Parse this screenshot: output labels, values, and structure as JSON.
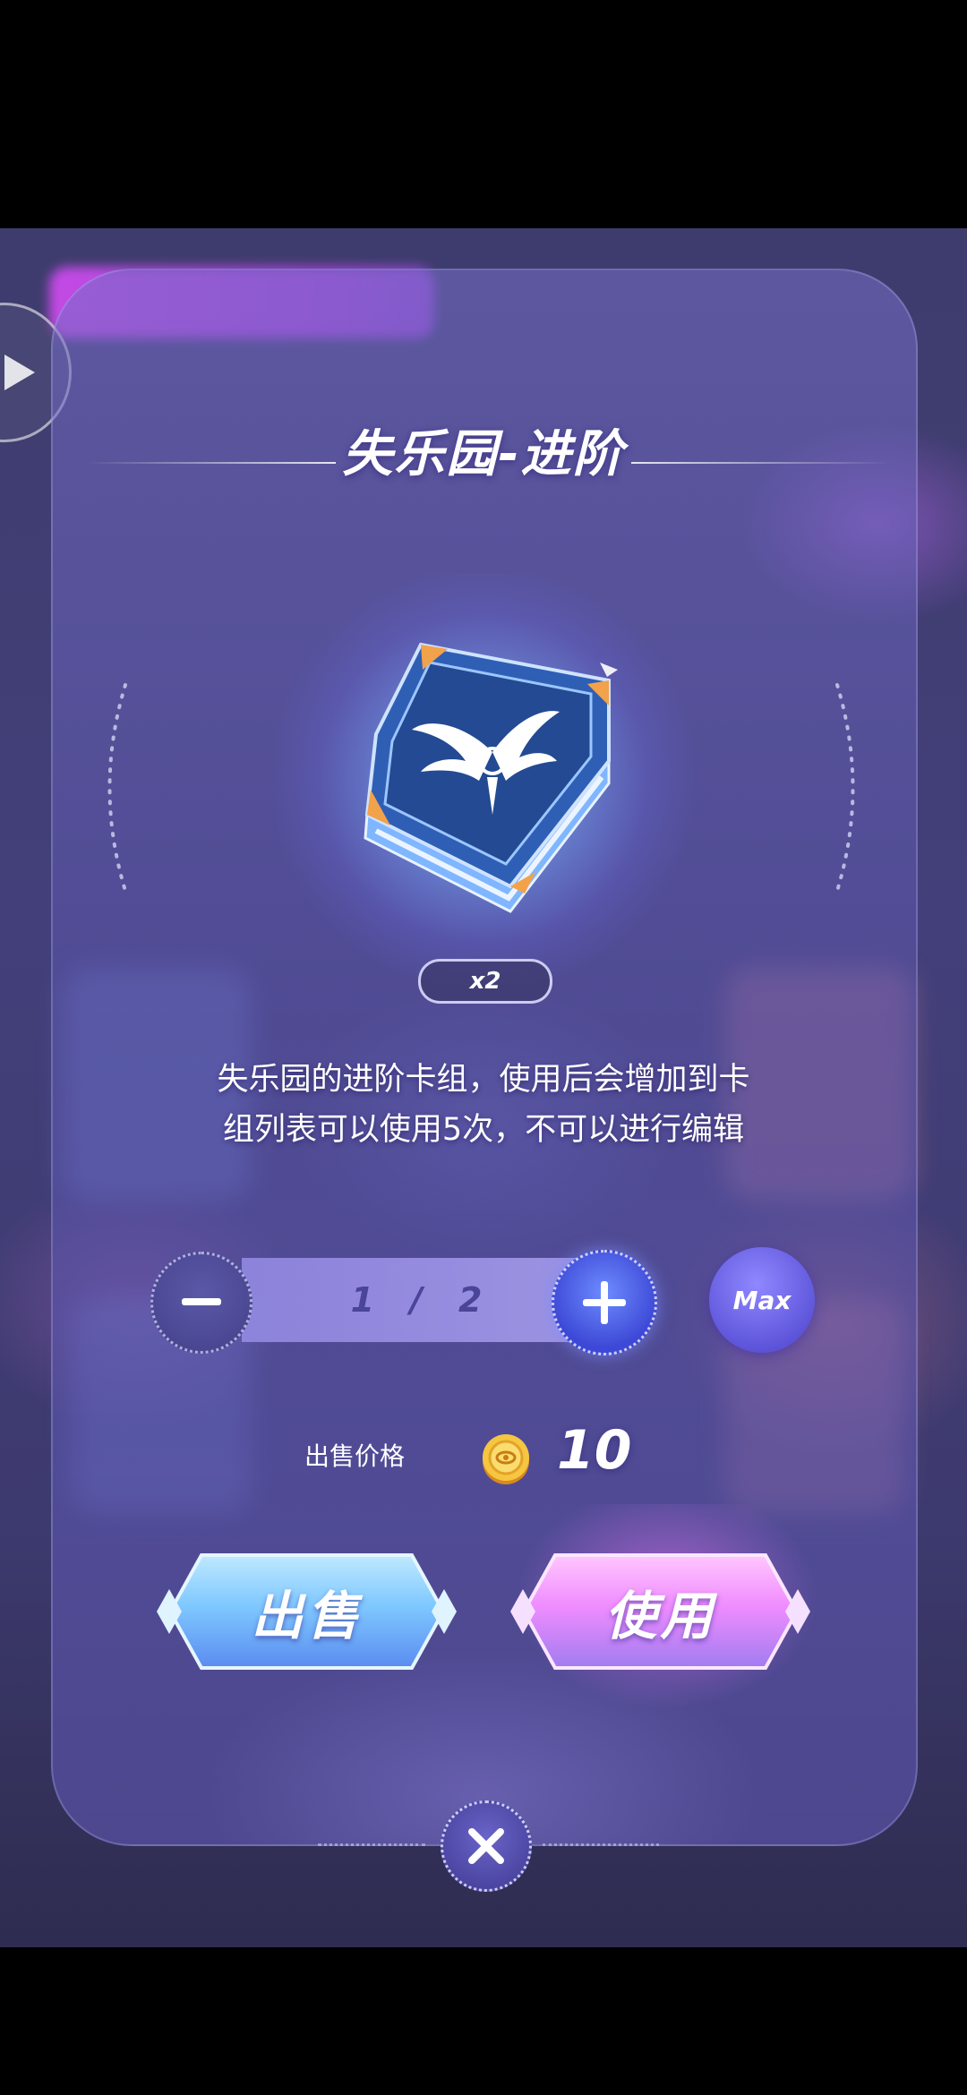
{
  "dialog": {
    "title": "失乐园-进阶",
    "item_count_badge": "x2",
    "description_line1": "失乐园的进阶卡组，使用后会增加到卡",
    "description_line2": "组列表可以使用5次，不可以进行编辑",
    "quantity": {
      "current": "1",
      "separator": "/",
      "max": "2",
      "max_button_label": "Max"
    },
    "price": {
      "label": "出售价格",
      "value": "10"
    },
    "sell_button_label": "出售",
    "use_button_label": "使用"
  },
  "icons": {
    "item": "card-deck-book-icon",
    "coin": "coin-icon",
    "minus": "minus-icon",
    "plus": "plus-icon",
    "close": "close-icon",
    "side_arrow": "play-arrow-icon"
  },
  "colors": {
    "sell_button": "#7fc8ff",
    "use_button": "#f08cff",
    "plus_button": "#4e5ee6",
    "max_button": "#7068ee"
  }
}
